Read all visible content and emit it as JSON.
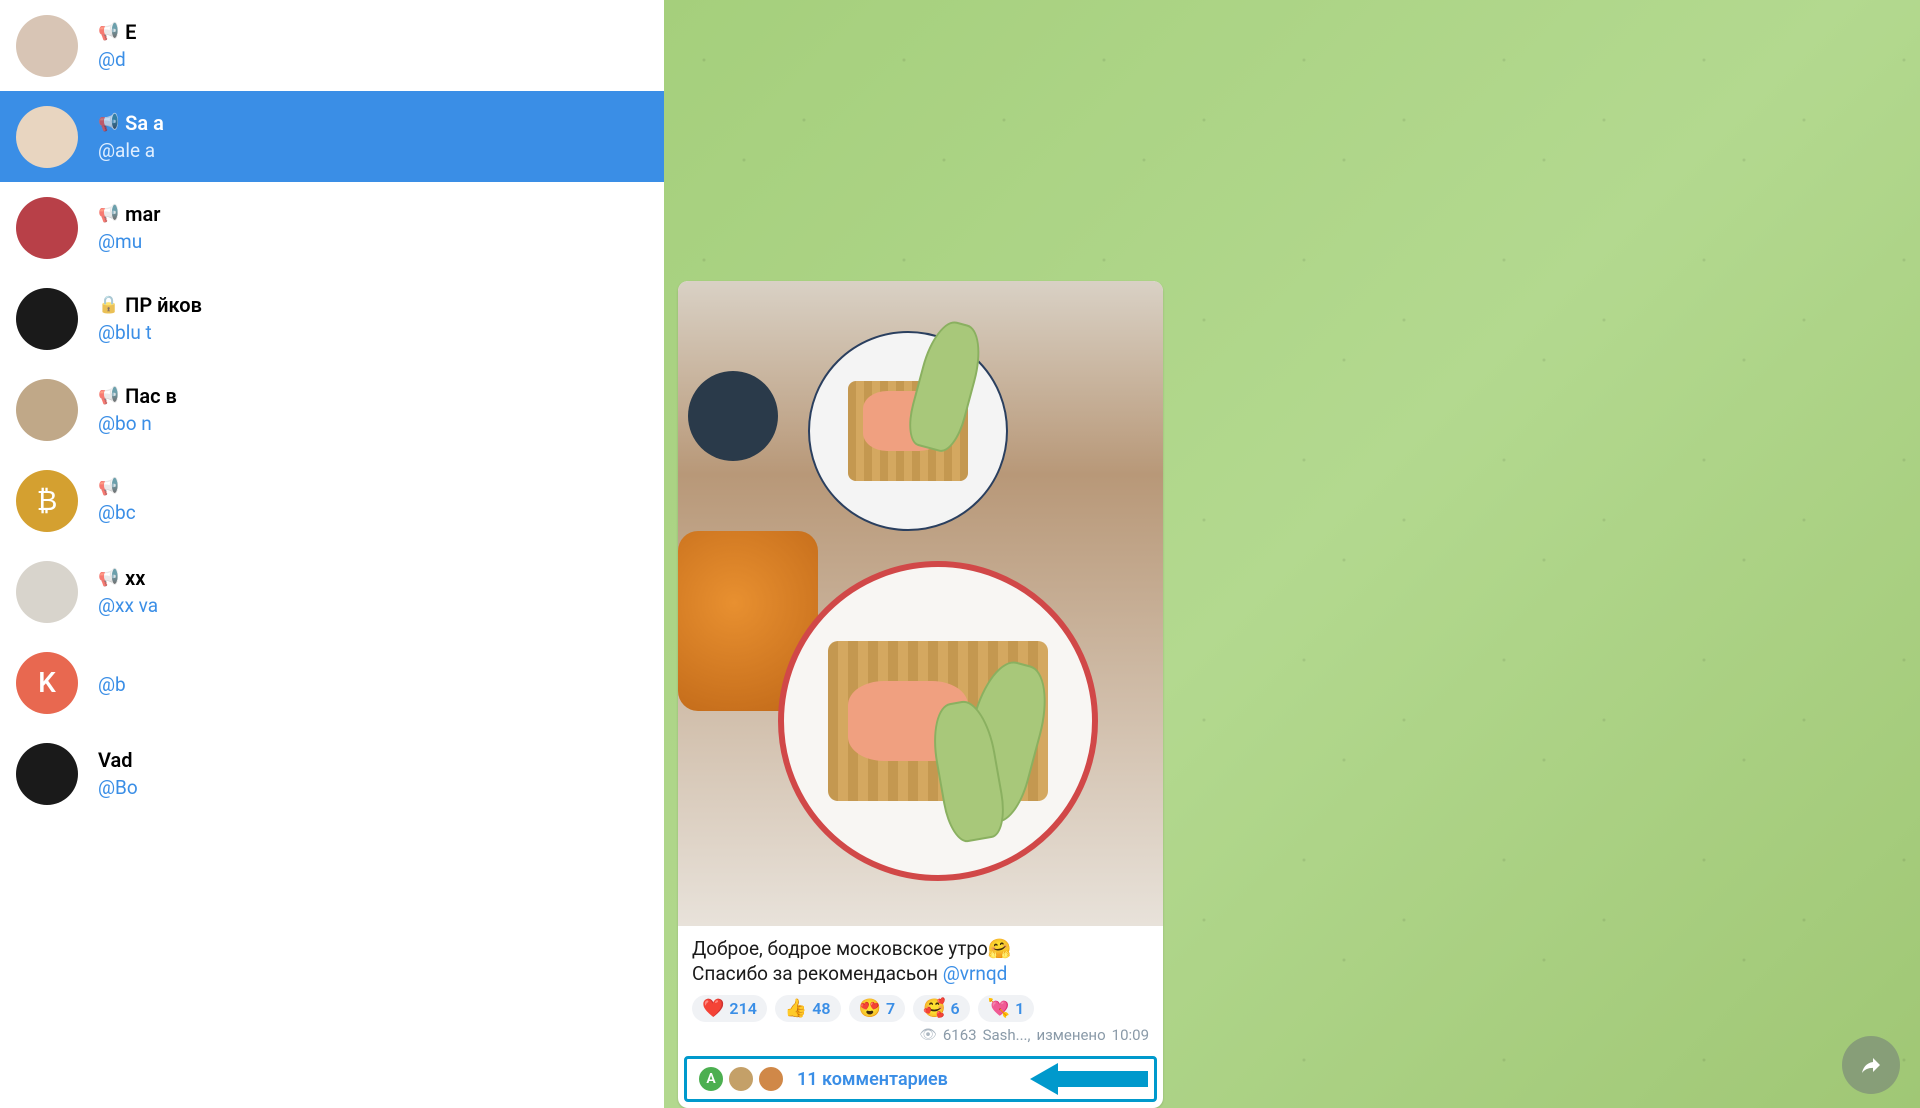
{
  "contacts": [
    {
      "title": "E",
      "handle": "@d",
      "avatar_bg": "#d8c5b5",
      "letter": "",
      "channel": true,
      "selected": false
    },
    {
      "title": "Sa                    a",
      "handle": "@ale                         a",
      "avatar_bg": "#e8d5c0",
      "letter": "",
      "channel": true,
      "selected": true
    },
    {
      "title": "mar",
      "handle": "@mu",
      "avatar_bg": "#b84048",
      "letter": "",
      "channel": true,
      "selected": false
    },
    {
      "title": "ПР                             йков",
      "handle": "@blu                t",
      "avatar_bg": "#1a1a1a",
      "letter": "",
      "channel": true,
      "selected": false,
      "lock": true
    },
    {
      "title": "Пас                            в",
      "handle": "@bo            n",
      "avatar_bg": "#c0a888",
      "letter": "",
      "channel": true,
      "selected": false
    },
    {
      "title": " ",
      "handle": "@bc",
      "avatar_bg": "#d4a030",
      "letter": "₿",
      "channel": true,
      "selected": false
    },
    {
      "title": "xx",
      "handle": "@xx         va",
      "avatar_bg": "#d8d4cc",
      "letter": "",
      "channel": true,
      "selected": false
    },
    {
      "title": " ",
      "handle": "@b",
      "avatar_bg": "#e86850",
      "letter": "K",
      "channel": false,
      "selected": false
    },
    {
      "title": "Vad",
      "handle": "@Bo",
      "avatar_bg": "#1a1a1a",
      "letter": "",
      "channel": false,
      "selected": false
    }
  ],
  "message": {
    "text_line1": "Доброе, бодрое московское утро",
    "emoji1": "🤗",
    "text_line2": "Спасибо за рекомендасьон ",
    "mention": "@vrnqd",
    "reactions": [
      {
        "emoji": "❤️",
        "count": "214"
      },
      {
        "emoji": "👍",
        "count": "48"
      },
      {
        "emoji": "😍",
        "count": "7"
      },
      {
        "emoji": "🥰",
        "count": "6"
      },
      {
        "emoji": "💘",
        "count": "1"
      }
    ],
    "views": "6163",
    "author": "Sash...,",
    "edited": "изменено",
    "time": "10:09"
  },
  "comments": {
    "label": "11 комментариев",
    "avatars": [
      "A",
      "",
      ""
    ]
  }
}
